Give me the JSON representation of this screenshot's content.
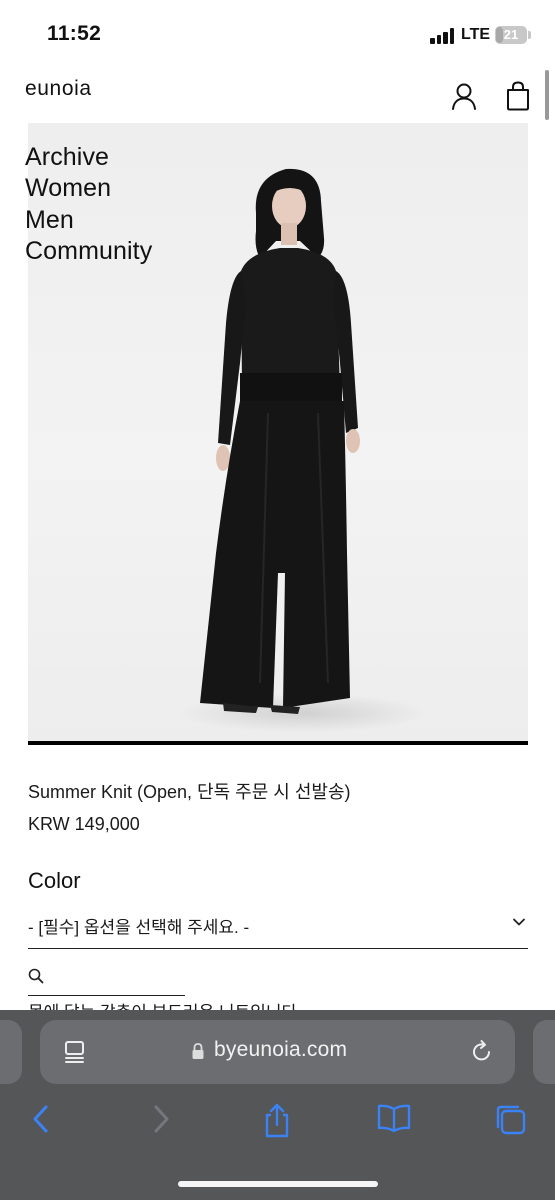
{
  "status_bar": {
    "time": "11:52",
    "network": "LTE",
    "battery_text": "21",
    "battery_level": 0.21
  },
  "header": {
    "logo": "eunoia",
    "icons": [
      "account-icon",
      "shopping-bag-icon"
    ]
  },
  "nav_menu": {
    "items": [
      "Archive",
      "Women",
      "Men",
      "Community"
    ]
  },
  "product": {
    "name": "Summer Knit (Open, 단독 주문 시 선발송)",
    "price": "KRW 149,000",
    "option_label": "Color",
    "option_placeholder": "- [필수] 옵션을 선택해 주세요. -"
  },
  "teaser_text": "몸에 닿는 감촉이 부드러운 니트입니다",
  "browser": {
    "url": "byeunoia.com",
    "toolbar": [
      "back-icon",
      "forward-icon",
      "share-icon",
      "bookmarks-icon",
      "tabs-icon"
    ]
  },
  "colors": {
    "accent_blue": "#3b82f6",
    "browser_bar": "#545658",
    "url_field": "#6b6d70"
  }
}
